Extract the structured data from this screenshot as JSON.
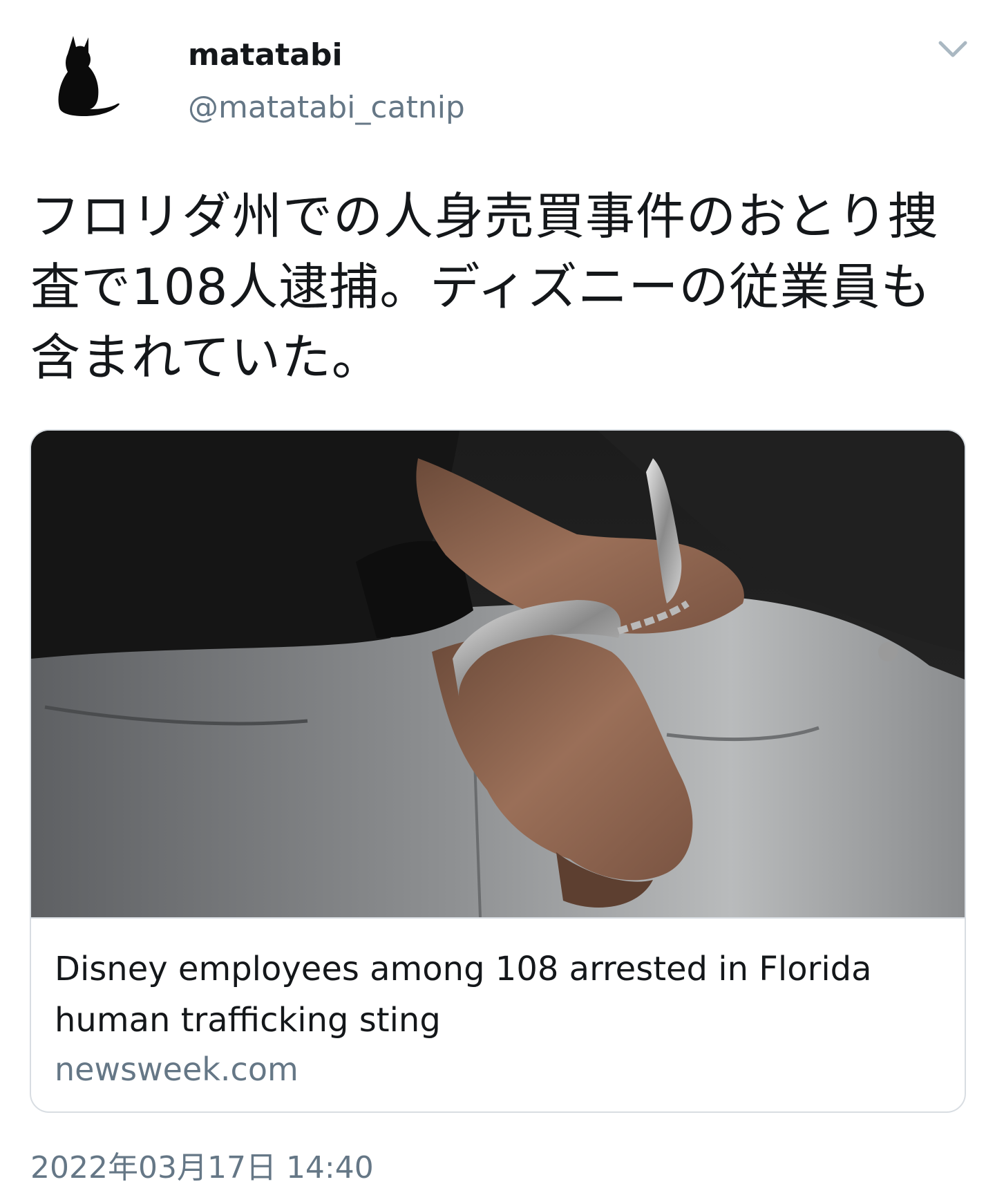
{
  "author": {
    "display_name": "matatabi",
    "handle": "@matatabi_catnip",
    "avatar_icon": "black-cat-silhouette-icon"
  },
  "menu": {
    "icon": "chevron-down-icon",
    "color": "#aab8c2"
  },
  "tweet": {
    "text": "フロリダ州での人身売買事件のおとり捜査で108人逮捕。ディズニーの従業員も含まれていた。"
  },
  "link_card": {
    "title": "Disney employees among 108 arrested in Florida human trafficking sting",
    "domain": "newsweek.com",
    "image_subject": "handcuffed-wrists-photo"
  },
  "meta": {
    "timestamp": "2022年03月17日 14:40"
  },
  "colors": {
    "text_primary": "#14171a",
    "text_secondary": "#657786",
    "border": "#d8dde2"
  }
}
